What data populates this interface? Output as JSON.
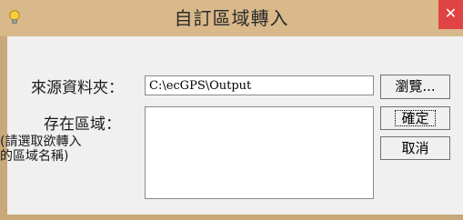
{
  "window": {
    "title": "自訂區域轉入",
    "close_glyph": "✕"
  },
  "form": {
    "source_label": "來源資料夾：",
    "source_value": "C:\\ecGPS\\Output",
    "area_label": "存在區域：",
    "area_hint": "(請選取欲轉入\n的區域名稱)"
  },
  "buttons": {
    "browse": "瀏覽...",
    "ok": "確定",
    "cancel": "取消"
  },
  "colors": {
    "titlebar": "#d9b88a",
    "close": "#e04343"
  }
}
